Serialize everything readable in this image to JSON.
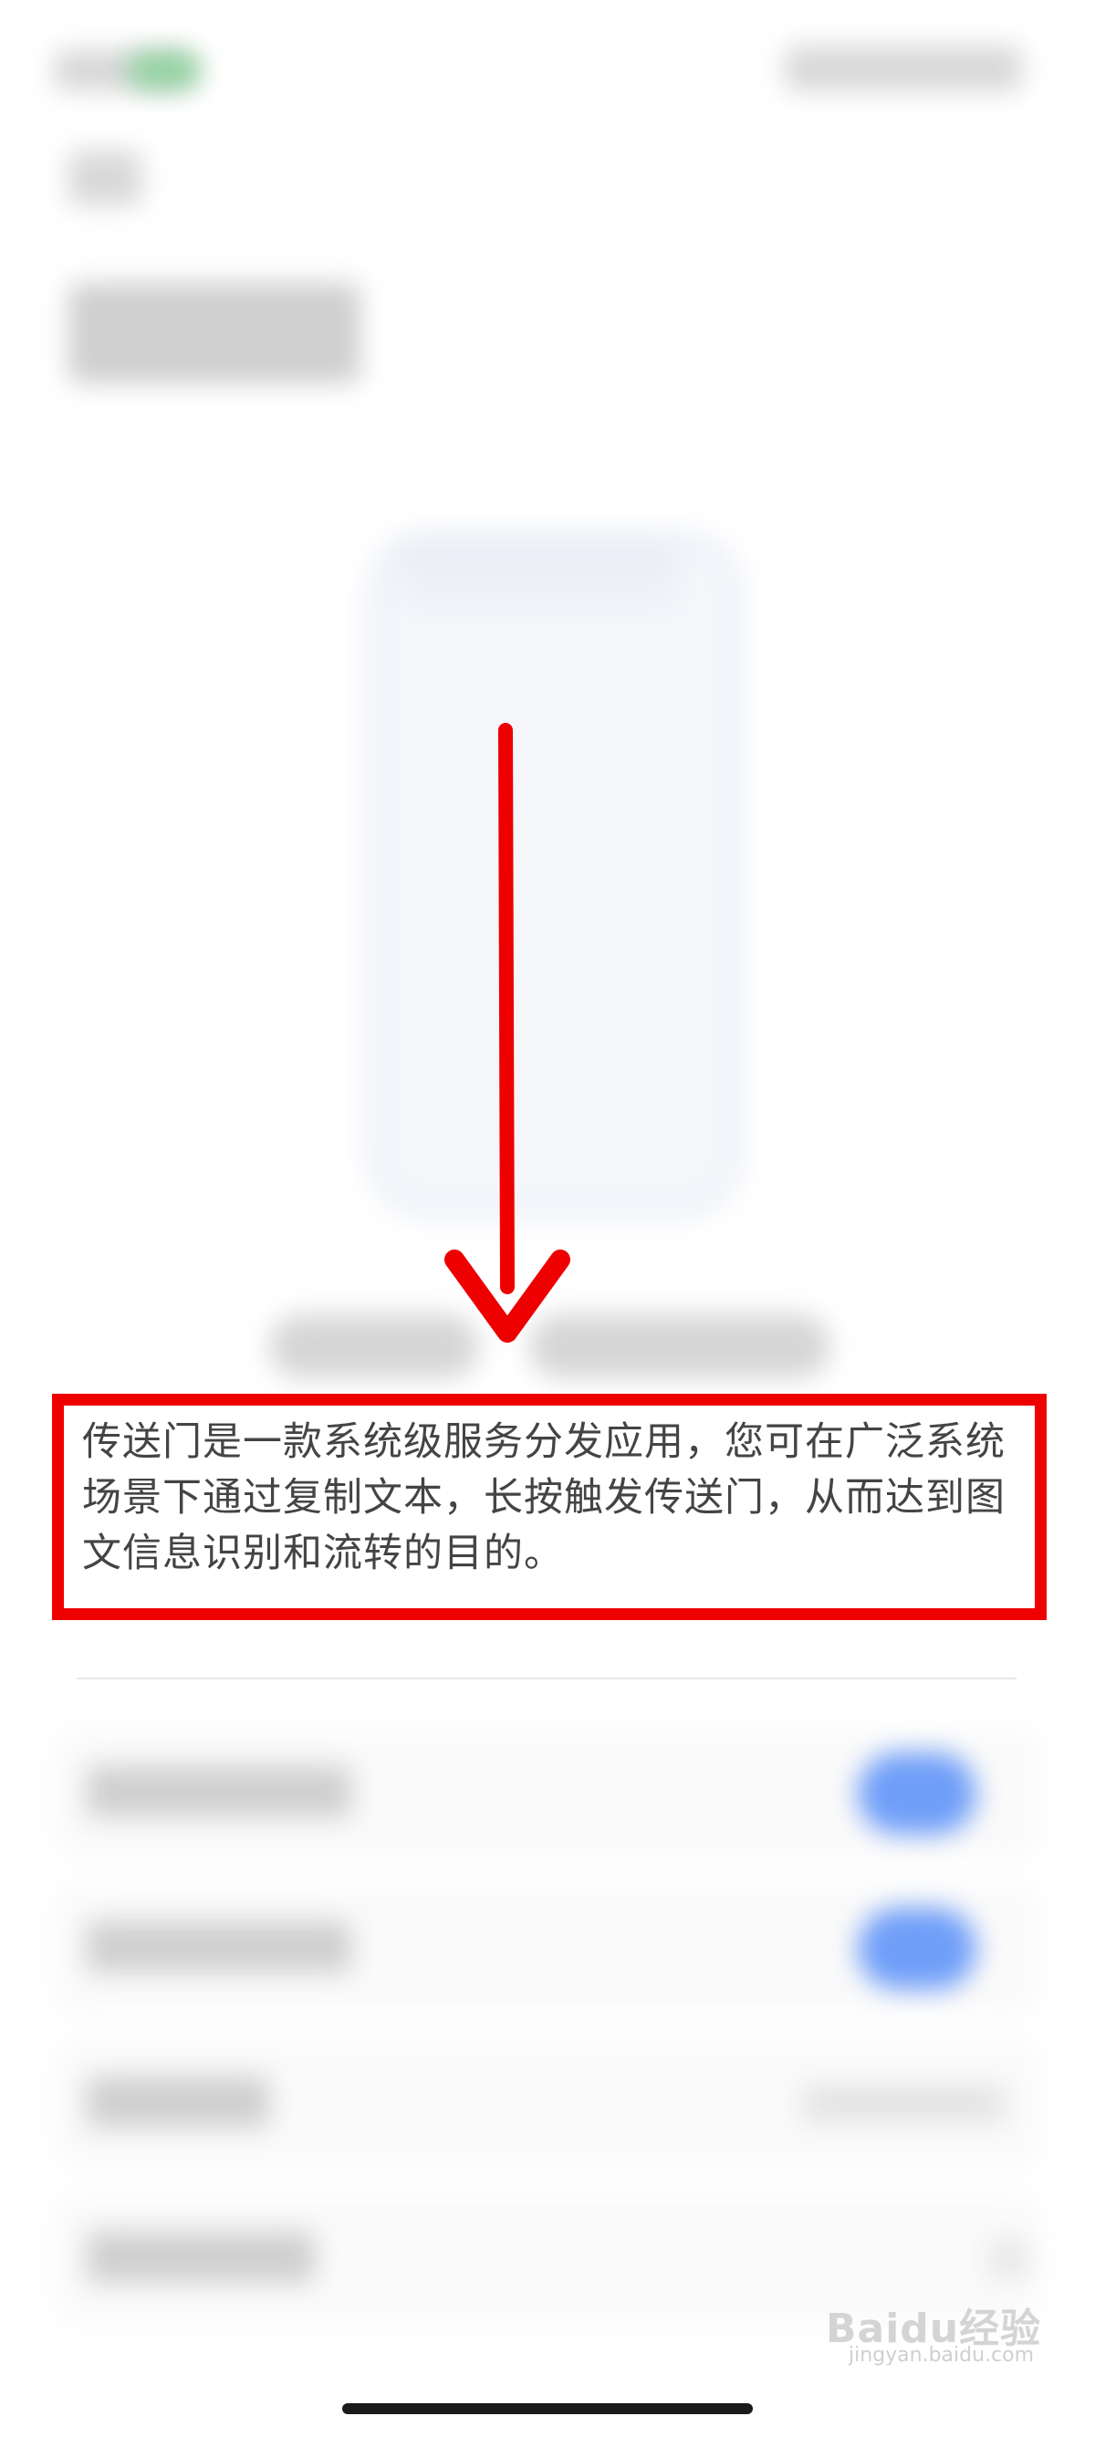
{
  "description": {
    "text": "传送门是一款系统级服务分发应用，您可在广泛系统场景下通过复制文本，长按触发传送门，从而达到图文信息识别和流转的目的。"
  },
  "colors": {
    "annotation_red": "#ee0000",
    "toggle_blue": "#6f9ef8",
    "text": "#444444"
  },
  "annotation": {
    "arrow_icon": "arrow-down-icon"
  },
  "watermark": {
    "logo": "Baidu经验",
    "url": "jingyan.baidu.com"
  }
}
